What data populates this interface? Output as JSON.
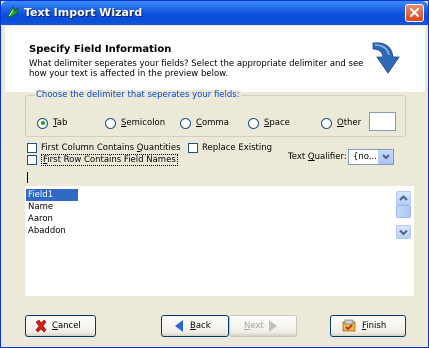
{
  "window": {
    "title": "Text Import Wizard"
  },
  "header": {
    "title": "Specify Field Information",
    "description": "What delimiter seperates your fields? Select the appropriate delimiter and see how your text is affected in the preview below."
  },
  "delimiter_group": {
    "legend": "Choose the delimiter that seperates your fields:",
    "options": [
      {
        "label_pre": "",
        "label_key": "T",
        "label_post": "ab",
        "selected": true
      },
      {
        "label_pre": "",
        "label_key": "S",
        "label_post": "emicolon",
        "selected": false
      },
      {
        "label_pre": "",
        "label_key": "C",
        "label_post": "omma",
        "selected": false
      },
      {
        "label_pre": "",
        "label_key": "S",
        "label_post": "pace",
        "selected": false
      },
      {
        "label_pre": "",
        "label_key": "O",
        "label_post": "ther",
        "selected": false
      }
    ],
    "other_value": ""
  },
  "options": {
    "first_column_quantities": {
      "pre": "First Column Contains ",
      "key": "Q",
      "post": "uantities",
      "checked": false
    },
    "first_row_field_names": {
      "pre": "",
      "key": "F",
      "post": "irst Row Contains Field Names",
      "checked": false
    },
    "replace_existing": {
      "label": "Replace Existing",
      "checked": false
    }
  },
  "text_qualifier": {
    "label_pre": "Text ",
    "label_key": "Q",
    "label_post": "ualifier:",
    "value": "{no..."
  },
  "preview": {
    "rows": [
      "Field1",
      "Name",
      "Aaron",
      "Abaddon"
    ],
    "selected_index": 0
  },
  "buttons": {
    "cancel": {
      "key": "C",
      "post": "ancel"
    },
    "back": {
      "key": "B",
      "post": "ack"
    },
    "next": {
      "key": "N",
      "post": "ext"
    },
    "finish": {
      "key": "F",
      "post": "inish"
    }
  },
  "colors": {
    "titlebar": "#0a4ed8",
    "legend_text": "#0046d5",
    "selection": "#316ac5",
    "window_bg": "#ece9d8"
  },
  "icons": {
    "title": "wizard-icon",
    "header": "curved-arrow-icon",
    "cancel": "red-x-icon",
    "back": "left-arrow-icon",
    "next": "right-arrow-icon",
    "finish": "finish-icon"
  }
}
